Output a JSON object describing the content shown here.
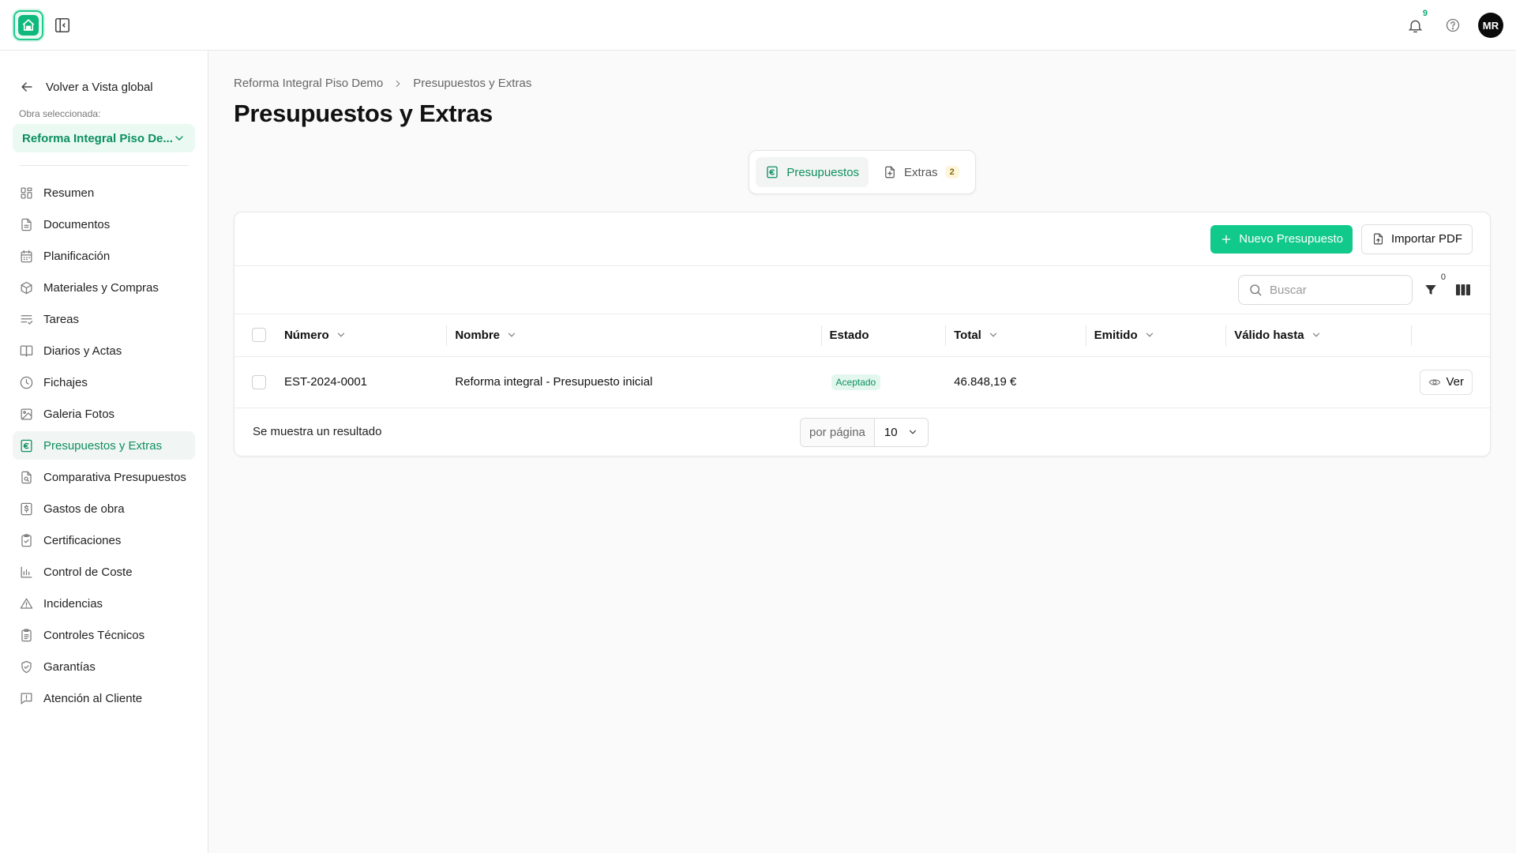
{
  "topbar": {
    "notifications_count": "9",
    "avatar_initials": "MR"
  },
  "sidebar": {
    "back_label": "Volver a Vista global",
    "obra_label": "Obra seleccionada:",
    "obra_value": "Reforma Integral Piso De...",
    "items": [
      {
        "label": "Resumen",
        "icon": "grid-icon"
      },
      {
        "label": "Documentos",
        "icon": "document-icon"
      },
      {
        "label": "Planificación",
        "icon": "calendar-icon"
      },
      {
        "label": "Materiales y Compras",
        "icon": "package-icon"
      },
      {
        "label": "Tareas",
        "icon": "checklist-icon"
      },
      {
        "label": "Diarios y Actas",
        "icon": "book-icon"
      },
      {
        "label": "Fichajes",
        "icon": "clock-icon"
      },
      {
        "label": "Galeria Fotos",
        "icon": "image-icon"
      },
      {
        "label": "Presupuestos y Extras",
        "icon": "euro-icon"
      },
      {
        "label": "Comparativa Presupuestos",
        "icon": "file-search-icon"
      },
      {
        "label": "Gastos de obra",
        "icon": "dollar-file-icon"
      },
      {
        "label": "Certificaciones",
        "icon": "clipboard-check-icon"
      },
      {
        "label": "Control de Coste",
        "icon": "bar-chart-icon"
      },
      {
        "label": "Incidencias",
        "icon": "warning-icon"
      },
      {
        "label": "Controles Técnicos",
        "icon": "clipboard-list-icon"
      },
      {
        "label": "Garantías",
        "icon": "shield-check-icon"
      },
      {
        "label": "Atención al Cliente",
        "icon": "message-alert-icon"
      }
    ],
    "active_index": 8
  },
  "breadcrumb": {
    "root": "Reforma Integral Piso Demo",
    "current": "Presupuestos y Extras"
  },
  "page_title": "Presupuestos y Extras",
  "tabs": {
    "presupuestos": "Presupuestos",
    "extras": "Extras",
    "extras_count": "2"
  },
  "actions": {
    "new_label": "Nuevo Presupuesto",
    "import_label": "Importar PDF"
  },
  "toolbar": {
    "search_placeholder": "Buscar",
    "filter_count": "0"
  },
  "table": {
    "headers": {
      "numero": "Número",
      "nombre": "Nombre",
      "estado": "Estado",
      "total": "Total",
      "emitido": "Emitido",
      "valido": "Válido hasta"
    },
    "rows": [
      {
        "numero": "EST-2024-0001",
        "nombre": "Reforma integral - Presupuesto inicial",
        "estado": "Aceptado",
        "total": "46.848,19 €",
        "emitido": "",
        "valido": "",
        "action": "Ver"
      }
    ]
  },
  "footer": {
    "results": "Se muestra un resultado",
    "per_page_label": "por página",
    "per_page_value": "10"
  }
}
